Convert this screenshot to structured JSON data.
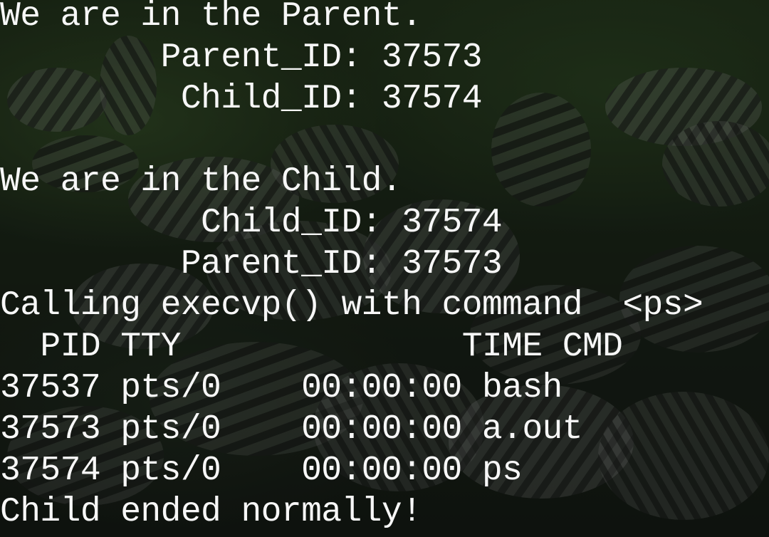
{
  "terminal": {
    "lines": [
      "We are in the Parent.",
      "        Parent_ID: 37573",
      "         Child_ID: 37574",
      "",
      "We are in the Child.",
      "          Child_ID: 37574",
      "         Parent_ID: 37573",
      "Calling execvp() with command  <ps>",
      "  PID TTY              TIME CMD",
      "37537 pts/0    00:00:00 bash",
      "37573 pts/0    00:00:00 a.out",
      "37574 pts/0    00:00:00 ps",
      "Child ended normally!"
    ]
  }
}
